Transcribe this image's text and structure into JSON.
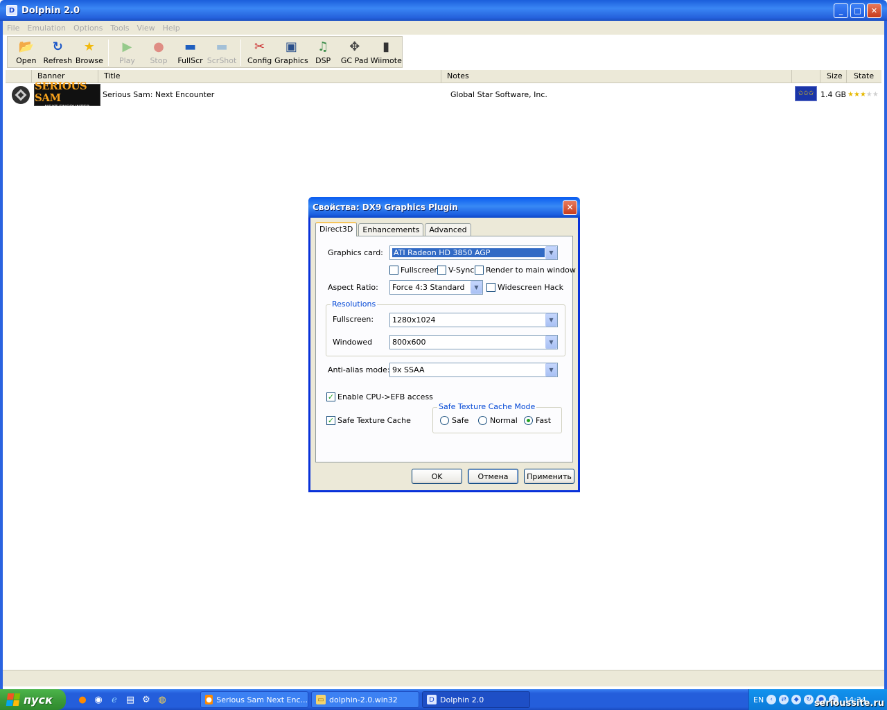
{
  "window": {
    "title": "Dolphin 2.0"
  },
  "menu": [
    "File",
    "Emulation",
    "Options",
    "Tools",
    "View",
    "Help"
  ],
  "toolbar": [
    {
      "label": "Open",
      "icon": "open-icon",
      "enabled": true
    },
    {
      "label": "Refresh",
      "icon": "refresh-icon",
      "enabled": true
    },
    {
      "label": "Browse",
      "icon": "browse-icon",
      "enabled": true
    },
    {
      "label": "Play",
      "icon": "play-icon",
      "enabled": false
    },
    {
      "label": "Stop",
      "icon": "stop-icon",
      "enabled": false
    },
    {
      "label": "FullScr",
      "icon": "fullscreen-icon",
      "enabled": true
    },
    {
      "label": "ScrShot",
      "icon": "screenshot-icon",
      "enabled": false
    },
    {
      "label": "Config",
      "icon": "config-icon",
      "enabled": true
    },
    {
      "label": "Graphics",
      "icon": "graphics-icon",
      "enabled": true
    },
    {
      "label": "DSP",
      "icon": "dsp-icon",
      "enabled": true
    },
    {
      "label": "GC Pad",
      "icon": "gc-pad-icon",
      "enabled": true
    },
    {
      "label": "Wiimote",
      "icon": "wiimote-icon",
      "enabled": true
    }
  ],
  "list": {
    "columns": {
      "banner": "Banner",
      "title": "Title",
      "notes": "Notes",
      "size": "Size",
      "state": "State"
    },
    "rows": [
      {
        "banner_line1": "SERIOUS SAM",
        "banner_line2": "NEXT ENCOUNTER",
        "title": "Serious Sam: Next Encounter",
        "notes": "Global Star Software, Inc.",
        "size": "1.4 GB",
        "region_icon": "eu-flag-icon",
        "stars": 3,
        "stars_max": 5
      }
    ]
  },
  "dialog": {
    "title": "Свойства: DX9 Graphics Plugin",
    "tabs": [
      "Direct3D",
      "Enhancements",
      "Advanced"
    ],
    "active_tab": "Direct3D",
    "graphics_card": {
      "label": "Graphics card:",
      "value": "ATI Radeon HD 3850 AGP"
    },
    "fullscreen_check": {
      "label": "Fullscreen",
      "checked": false
    },
    "vsync_check": {
      "label": "V-Sync",
      "checked": false
    },
    "render_main_check": {
      "label": "Render to main window",
      "checked": false
    },
    "aspect": {
      "label": "Aspect Ratio:",
      "value": "Force 4:3 Standard"
    },
    "widescreen_check": {
      "label": "Widescreen Hack",
      "checked": false
    },
    "resolutions": {
      "title": "Resolutions",
      "fullscreen_label": "Fullscreen:",
      "fullscreen_value": "1280x1024",
      "windowed_label": "Windowed",
      "windowed_value": "800x600"
    },
    "antialias": {
      "label": "Anti-alias mode:",
      "value": "9x SSAA"
    },
    "efb_check": {
      "label": "Enable CPU->EFB access",
      "checked": true
    },
    "safe_cache_check": {
      "label": "Safe Texture Cache",
      "checked": true
    },
    "cache_mode": {
      "title": "Safe Texture Cache Mode",
      "options": [
        "Safe",
        "Normal",
        "Fast"
      ],
      "selected": "Fast"
    },
    "buttons": {
      "ok": "OK",
      "cancel": "Отмена",
      "apply": "Применить"
    }
  },
  "taskbar": {
    "start": "пуск",
    "tasks": [
      {
        "label": "Serious Sam Next Enc...",
        "active": false
      },
      {
        "label": "dolphin-2.0.win32",
        "active": false
      },
      {
        "label": "Dolphin 2.0",
        "active": true
      }
    ],
    "lang": "EN",
    "clock": "14:34",
    "watermark": "serioussite.ru"
  }
}
